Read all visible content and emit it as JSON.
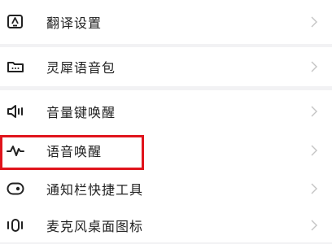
{
  "settings": {
    "items": [
      {
        "label": "翻译设置",
        "icon": "translate-icon"
      },
      {
        "label": "灵犀语音包",
        "icon": "voice-pack-icon"
      },
      {
        "label": "音量键唤醒",
        "icon": "volume-key-icon"
      },
      {
        "label": "语音唤醒",
        "icon": "voice-wave-icon"
      },
      {
        "label": "通知栏快捷工具",
        "icon": "notification-toggle-icon"
      },
      {
        "label": "麦克风桌面图标",
        "icon": "microphone-desktop-icon"
      }
    ],
    "chevron_glyph": ">"
  },
  "highlight": {
    "color": "#e0141c",
    "target": "语音唤醒"
  }
}
